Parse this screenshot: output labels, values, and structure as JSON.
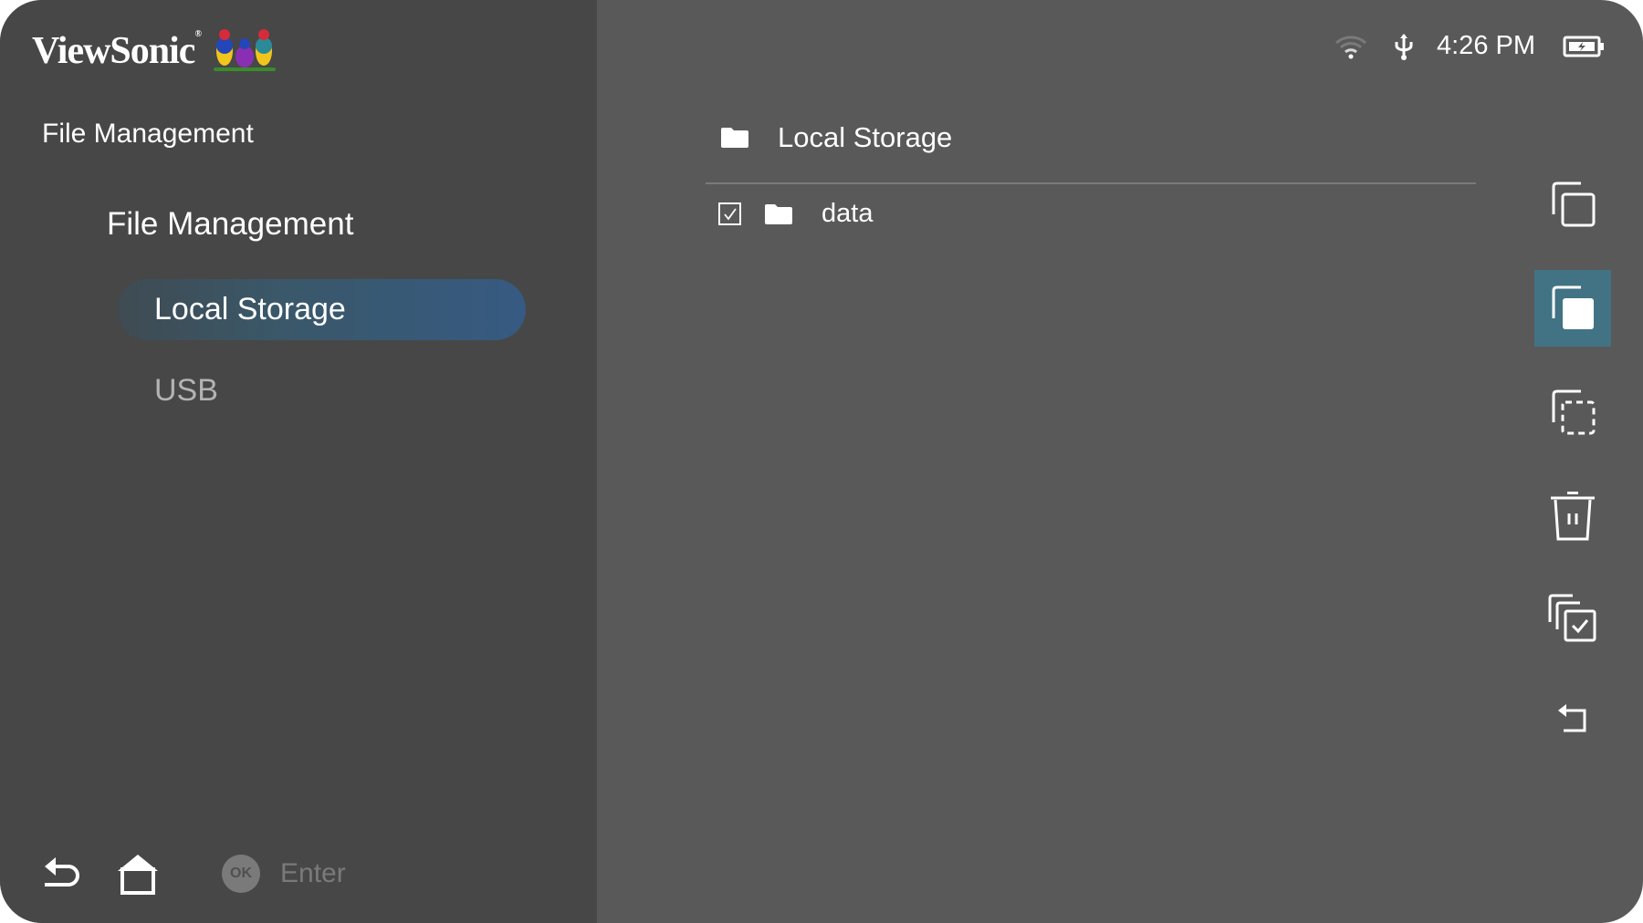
{
  "brand": {
    "name": "ViewSonic",
    "registered": "®",
    "mascot_icon": "birds-logo-icon"
  },
  "status_bar": {
    "wifi_icon": "wifi-icon",
    "usb_icon": "usb-icon",
    "time": "4:26 PM",
    "battery_icon": "battery-charging-icon"
  },
  "sidebar": {
    "title": "File Management",
    "section": "File Management",
    "items": [
      {
        "label": "Local Storage",
        "active": true
      },
      {
        "label": "USB",
        "active": false
      }
    ]
  },
  "bottom_hints": {
    "back_icon": "back-icon",
    "home_icon": "home-icon",
    "ok_badge": "OK",
    "ok_label": "Enter"
  },
  "content": {
    "breadcrumb": {
      "icon": "folder-icon",
      "label": "Local Storage"
    },
    "files": [
      {
        "name": "data",
        "type": "folder",
        "checked": true
      }
    ]
  },
  "toolbar": {
    "items": [
      {
        "name": "copy",
        "icon": "copy-icon",
        "active": false
      },
      {
        "name": "paste",
        "icon": "paste-icon",
        "active": true
      },
      {
        "name": "cut",
        "icon": "cut-icon",
        "active": false
      },
      {
        "name": "delete",
        "icon": "trash-icon",
        "active": false
      },
      {
        "name": "select-all",
        "icon": "select-all-icon",
        "active": false
      },
      {
        "name": "return",
        "icon": "return-icon",
        "active": false
      }
    ]
  },
  "colors": {
    "accent": "#417384",
    "sidebar_bg": "#474747",
    "content_bg": "#595959",
    "highlight_end": "#365a82"
  }
}
